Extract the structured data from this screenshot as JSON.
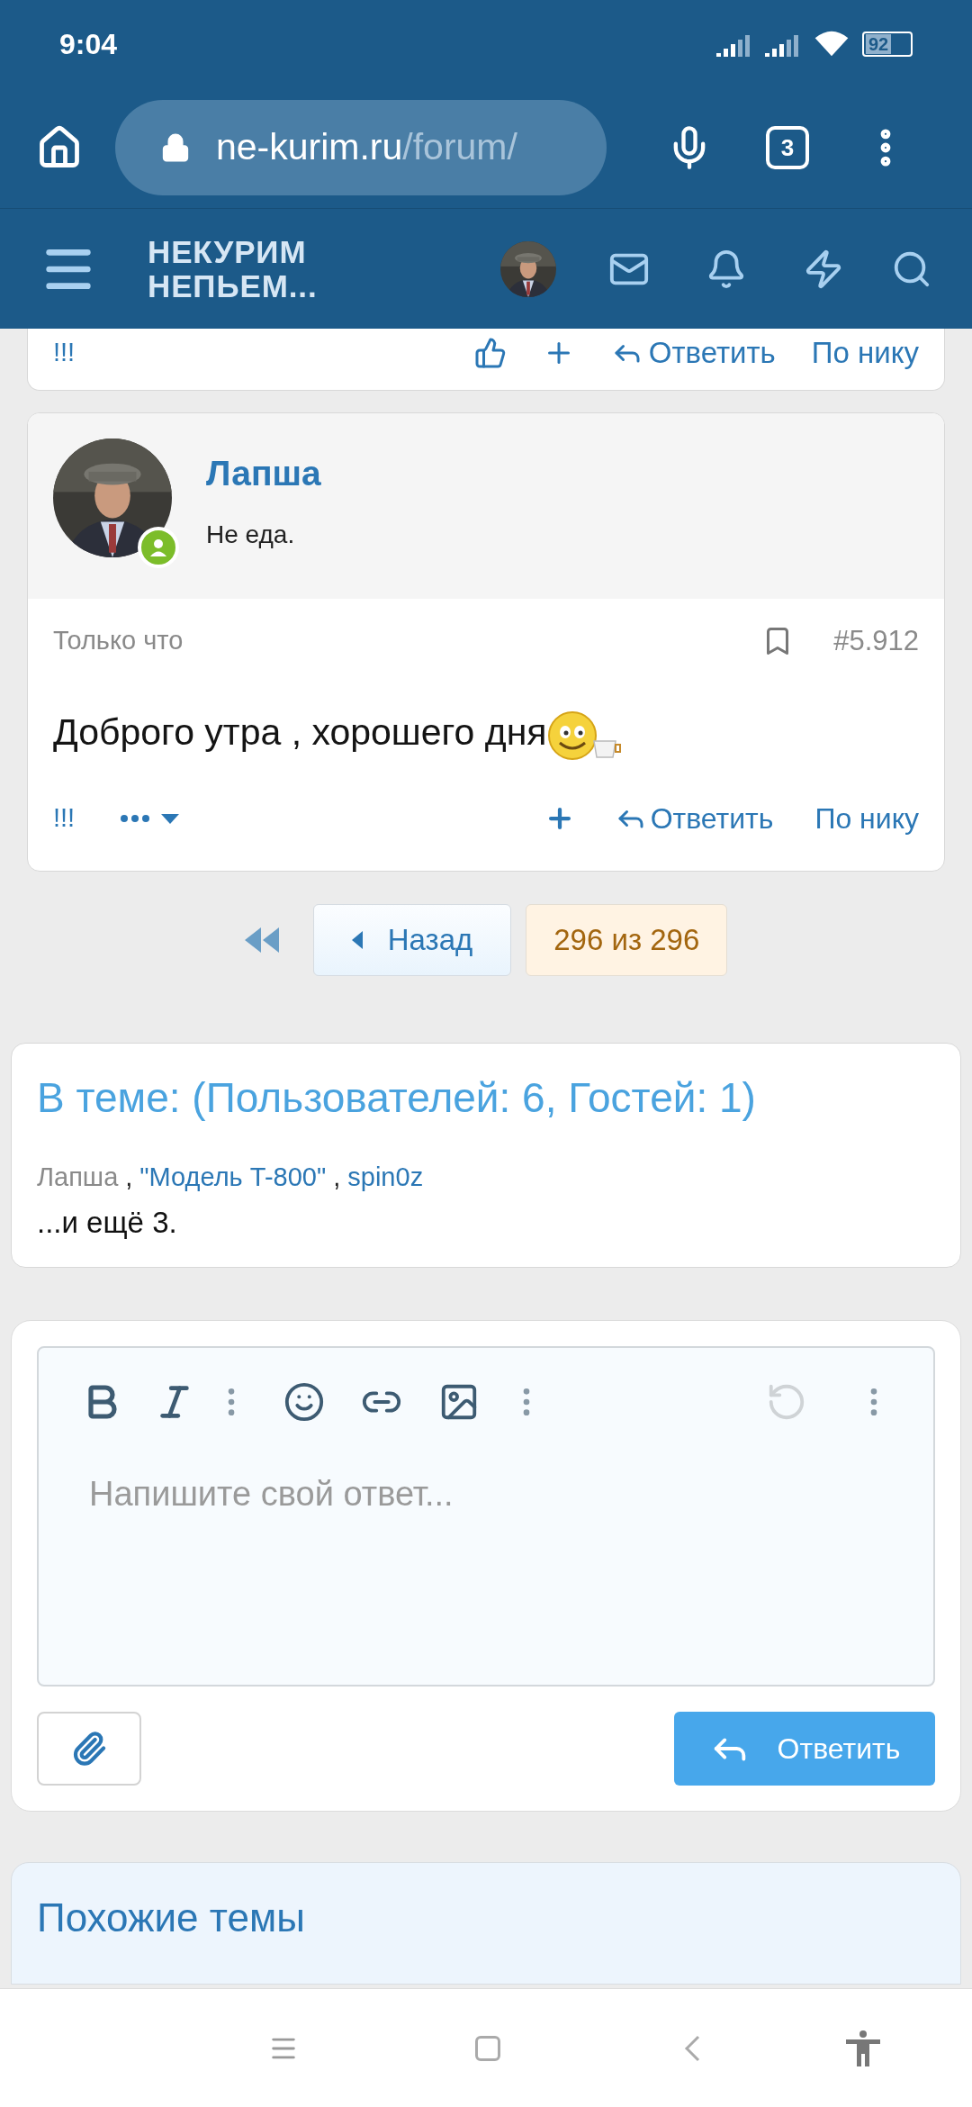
{
  "status_bar": {
    "time": "9:04",
    "battery": "92"
  },
  "browser": {
    "url_host": "ne-kurim.ru",
    "url_path": "/forum/",
    "tab_count": "3"
  },
  "forum_header": {
    "logo_lines": [
      "НЕКУРИМ",
      "НЕПЬЕМ..."
    ]
  },
  "previous_post": {
    "actions": [
      "!!!",
      "Ответить",
      "По нику"
    ]
  },
  "post": {
    "author": "Лапша",
    "user_title": "Не еда.",
    "online": true,
    "time": "Только что",
    "number": "#5.912",
    "text": "Доброго утра , хорошего дня",
    "react": "!!!",
    "reply": "Ответить",
    "by_nick": "По нику"
  },
  "pagination": {
    "back": "Назад",
    "current": "296 из 296"
  },
  "online_block": {
    "title": "В теме: (Пользователей: 6, Гостей: 1)",
    "separator": ",",
    "more": "...и ещё 3.",
    "users": [
      {
        "name": "Лапша",
        "kind": "plain"
      },
      {
        "name": "\"Модель T-800\"",
        "kind": "link"
      },
      {
        "name": "spin0z",
        "kind": "link"
      }
    ]
  },
  "editor": {
    "placeholder": "Напишите свой ответ...",
    "undo_disabled": true,
    "submit": "Ответить"
  },
  "similar": {
    "title": "Похожие темы"
  }
}
